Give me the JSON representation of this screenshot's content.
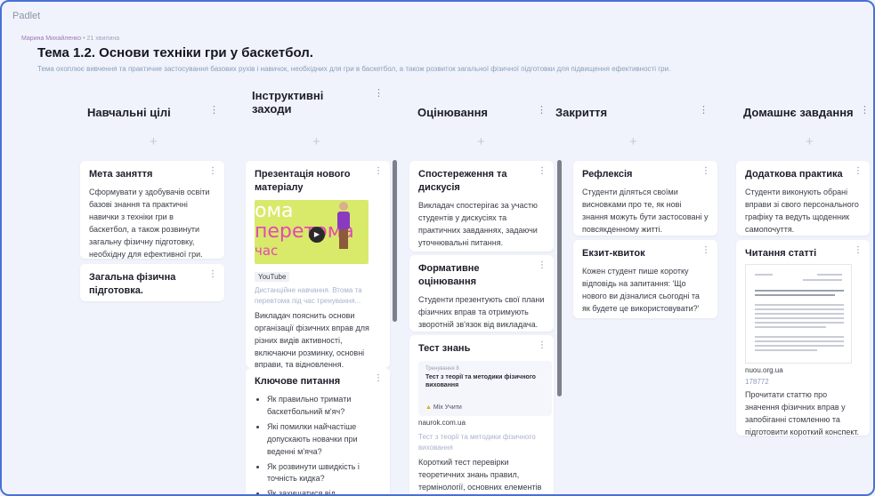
{
  "app": {
    "logo": "Padlet"
  },
  "author": {
    "name": "Марина Михайленко",
    "time": " • 21 хвилина"
  },
  "board": {
    "title": "Тема 1.2. Основи техніки гри у баскетбол.",
    "subtitle": "Тема охоплює вивчення та практичне застосування базових рухів і навичок, необхідних для гри в баскетбол, а також розвиток загальної фізичної підготовки для підвищення ефективності гри."
  },
  "columns": [
    {
      "title": "Навчальні цілі"
    },
    {
      "title": "Інструктивні заходи"
    },
    {
      "title": "Оцінювання"
    },
    {
      "title": "Закриття"
    },
    {
      "title": "Домашнє завдання"
    }
  ],
  "icons": {
    "kebab": "⋮",
    "add": "+",
    "play": "▶"
  },
  "cards": {
    "goal": {
      "title": "Мета заняття",
      "body": "Сформувати у здобувачів освіти базові знання та практичні навички з техніки гри в баскетбол, а також розвинути загальну фізичну підготовку, необхідну для ефективної гри."
    },
    "general": {
      "title": "Загальна фізична підготовка."
    },
    "presentation": {
      "title": "Презентація нового матеріалу",
      "video_lines": [
        "ома",
        "перетома",
        "час"
      ],
      "source": "YouTube",
      "caption": "Дистанційне навчання. Втома та перевтома під час тренування...",
      "body": "Викладач пояснить основи організації фізичних вправ для різних видів активності, включаючи розминку, основні вправи, та відновлення."
    },
    "questions": {
      "title": "Ключове питання",
      "items": [
        "Як правильно тримати баскетбольний м'яч?",
        "Які помилки найчастіше допускають новачки при веденні м'яча?",
        "Як розвинути швидкість і точність кидка?",
        "Як захищатися від"
      ]
    },
    "observation": {
      "title": "Спостереження та дискусія",
      "body": "Викладач спостерігає за участю студентів у дискусіях та практичних завданнях, задаючи уточнювальні питання."
    },
    "formative": {
      "title": "Формативне оцінювання",
      "body": "Студенти презентують свої плани фізичних вправ та отримують зворотній зв'язок від викладача."
    },
    "test": {
      "title": "Тест знань",
      "preview_kicker": "Тренування 8",
      "preview_title": "Тест з теорії та методики фізичного виховання",
      "preview_brand_icon": "▲",
      "preview_brand": "Міх Учити",
      "domain": "naurok.com.ua",
      "caption": "Тест з теорії та методики фізичного виховання",
      "body": "Короткий тест перевірки теоретичних знань правил, термінології, основних елементів техніки..."
    },
    "reflection": {
      "title": "Рефлексія",
      "body": "Студенти діляться своїми висновками про те, як нові знання можуть бути застосовані у повсякденному житті."
    },
    "exit": {
      "title": "Екзит-квиток",
      "body": "Кожен студент пише коротку відповідь на запитання: 'Що нового ви дізналися сьогодні та як будете це використовувати?'"
    },
    "practice": {
      "title": "Додаткова практика",
      "body": "Студенти виконують обрані вправи зі свого персонального графіку та ведуть щоденник самопочуття."
    },
    "reading": {
      "title": "Читання статті",
      "domain": "nuou.org.ua",
      "number": "178772",
      "body": "Прочитати статтю про значення фізичних вправ у запобіганні стомленню та підготовити короткий конспект."
    }
  },
  "colors": {
    "background": "#f0f3fb",
    "frame": "#4a6fd8",
    "card": "#ffffff",
    "scrollbar": "#7d808c"
  }
}
